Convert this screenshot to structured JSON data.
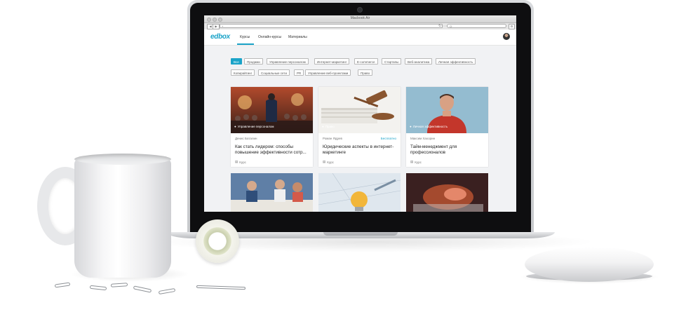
{
  "browser": {
    "window_title": "Macbook Air",
    "address_prefix": "+"
  },
  "app": {
    "logo": "edbox",
    "nav": [
      "Курсы",
      "Онлайн-курсы",
      "Материалы"
    ]
  },
  "filters": [
    {
      "label": "Все",
      "active": true
    },
    {
      "label": "Продажи"
    },
    {
      "label": "Управление персоналом"
    },
    {
      "label": "Интернет-маркетинг"
    },
    {
      "label": "E-commerce"
    },
    {
      "label": "Стартапы"
    },
    {
      "label": "Веб-аналитика"
    },
    {
      "label": "Личная эффективность"
    },
    {
      "label": "Копирайтинг"
    },
    {
      "label": "Социальные сети"
    },
    {
      "label": "PR"
    },
    {
      "label": "Управление веб-проектами"
    },
    {
      "label": "Право"
    }
  ],
  "cards": [
    {
      "category": "Управление персоналом",
      "author": "Денис Баталин",
      "price": "",
      "title": "Как стать лидером: способы повышение эффективности сотр...",
      "type": "Курс"
    },
    {
      "category": "Право",
      "author": "Роман Ядрев",
      "price": "Бесплатно",
      "title": "Юридические аспекты в интернет-маркетинге",
      "type": "Курс"
    },
    {
      "category": "Личная эффективность",
      "author": "Максим Хахорин",
      "price": "",
      "title": "Тайм-менеджмент для профессионалов",
      "type": "Курс"
    }
  ],
  "icons": {
    "category": "tag-icon",
    "type": "course-icon"
  },
  "colors": {
    "accent": "#1aa3c8"
  }
}
